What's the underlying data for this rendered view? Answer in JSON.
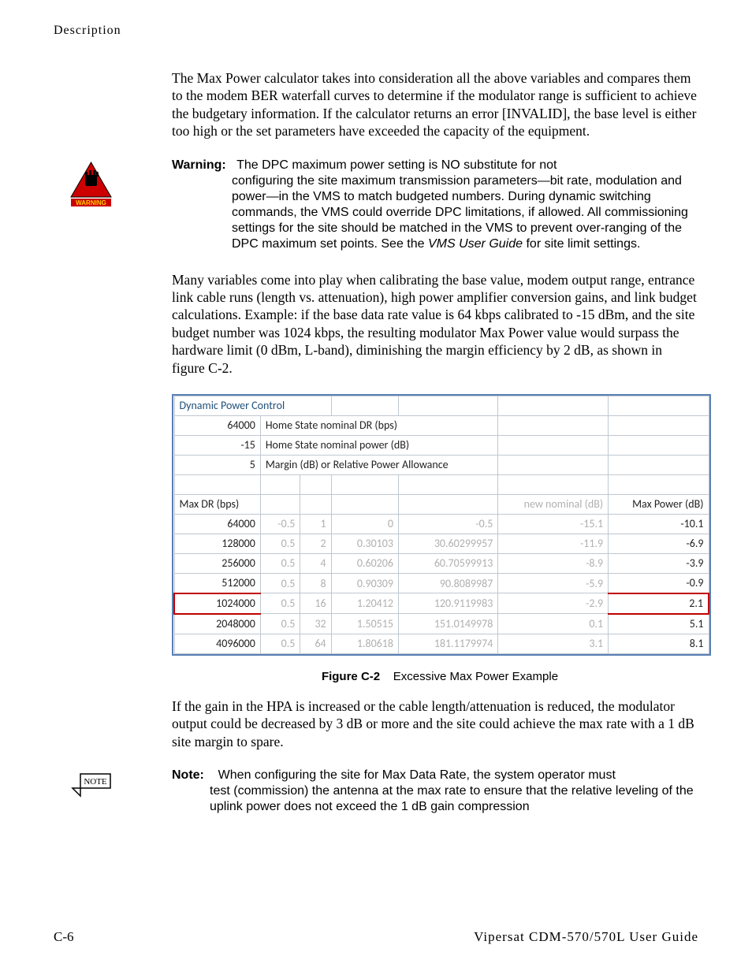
{
  "header": "Description",
  "para1": "The Max Power calculator takes into consideration all the above variables and compares them to the modem BER waterfall curves to determine if the modulator range is sufficient to achieve the budgetary information. If the calculator returns an error [INVALID], the base level is either too high or the set parameters have exceeded the capacity of the equipment.",
  "warning": {
    "label": "Warning:",
    "line1": "The DPC maximum power setting is NO substitute for not",
    "body": "configuring the site maximum transmission parameters—bit rate, modulation and power—in the VMS to match budgeted numbers. During dynamic switching commands, the VMS could override DPC limitations, if allowed. All commissioning settings for the site should be matched in the VMS to prevent over-ranging of the DPC maximum set points. See the ",
    "italic": "VMS User Guide",
    "tail": " for site limit settings."
  },
  "para2": "Many variables come into play when calibrating the base value, modem output range, entrance link cable runs (length vs. attenuation), high power amplifier conversion gains, and link budget calculations. Example: if the base data rate value is 64 kbps calibrated to -15 dBm, and the site budget number was 1024 kbps, the resulting modulator Max Power value would surpass the hardware limit (0 dBm, L-band), diminishing the margin efficiency by 2 dB, as shown in figure C-2.",
  "table": {
    "title": "Dynamic Power Control",
    "params": [
      {
        "value": "64000",
        "label": "Home State nominal DR (bps)"
      },
      {
        "value": "-15",
        "label": "Home State nominal power (dB)"
      },
      {
        "value": "5",
        "label": "Margin (dB) or Relative Power Allowance"
      }
    ],
    "headers": {
      "maxdr": "Max DR (bps)",
      "newnom": "new nominal (dB)",
      "maxpow": "Max Power (dB)"
    },
    "rows": [
      {
        "dr": "64000",
        "c2": "-0.5",
        "c3": "1",
        "c4": "0",
        "c5": "-0.5",
        "newnom": "-15.1",
        "maxpow": "-10.1",
        "hl": false
      },
      {
        "dr": "128000",
        "c2": "0.5",
        "c3": "2",
        "c4": "0.30103",
        "c5": "30.60299957",
        "newnom": "-11.9",
        "maxpow": "-6.9",
        "hl": false
      },
      {
        "dr": "256000",
        "c2": "0.5",
        "c3": "4",
        "c4": "0.60206",
        "c5": "60.70599913",
        "newnom": "-8.9",
        "maxpow": "-3.9",
        "hl": false
      },
      {
        "dr": "512000",
        "c2": "0.5",
        "c3": "8",
        "c4": "0.90309",
        "c5": "90.8089987",
        "newnom": "-5.9",
        "maxpow": "-0.9",
        "hl": false
      },
      {
        "dr": "1024000",
        "c2": "0.5",
        "c3": "16",
        "c4": "1.20412",
        "c5": "120.9119983",
        "newnom": "-2.9",
        "maxpow": "2.1",
        "hl": true
      },
      {
        "dr": "2048000",
        "c2": "0.5",
        "c3": "32",
        "c4": "1.50515",
        "c5": "151.0149978",
        "newnom": "0.1",
        "maxpow": "5.1",
        "hl": false
      },
      {
        "dr": "4096000",
        "c2": "0.5",
        "c3": "64",
        "c4": "1.80618",
        "c5": "181.1179974",
        "newnom": "3.1",
        "maxpow": "8.1",
        "hl": false
      }
    ]
  },
  "figure": {
    "label": "Figure C-2",
    "caption": "Excessive Max Power Example"
  },
  "para3": "If the gain in the HPA is increased or the cable length/attenuation is reduced, the modulator output could be decreased by 3 dB or more and the site could achieve the max rate with a 1 dB site margin to spare.",
  "note": {
    "label": "Note:",
    "line1": "When configuring the site for Max Data Rate, the system operator must",
    "body": "test (commission) the antenna at the max rate to ensure that the relative leveling of the uplink power does not exceed the 1 dB gain compression"
  },
  "footer": {
    "left": "C-6",
    "right": "Vipersat CDM-570/570L User Guide"
  },
  "noteIconText": "NOTE",
  "warnIconText": "WARNING"
}
